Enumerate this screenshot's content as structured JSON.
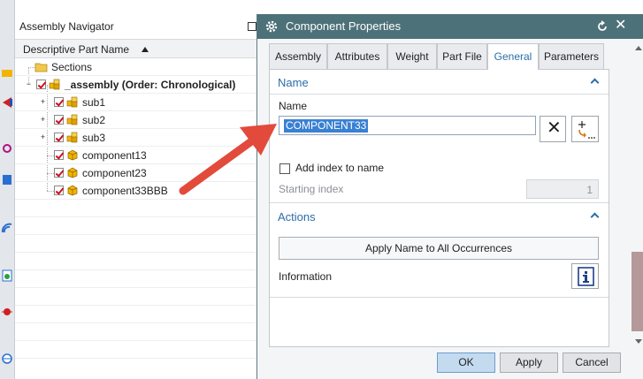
{
  "navigator": {
    "title": "Assembly Navigator",
    "column_header": "Descriptive Part Name",
    "rows": [
      {
        "label": "Sections",
        "bold": false
      },
      {
        "label": "_assembly (Order: Chronological)",
        "bold": true
      },
      {
        "label": "sub1",
        "bold": false
      },
      {
        "label": "sub2",
        "bold": false
      },
      {
        "label": "sub3",
        "bold": false
      },
      {
        "label": "component13",
        "bold": false
      },
      {
        "label": "component23",
        "bold": false
      },
      {
        "label": "component33BBB",
        "bold": false
      }
    ]
  },
  "dialog": {
    "title": "Component Properties",
    "tabs": [
      {
        "label": "Assembly",
        "active": false
      },
      {
        "label": "Attributes",
        "active": false
      },
      {
        "label": "Weight",
        "active": false
      },
      {
        "label": "Part File",
        "active": false
      },
      {
        "label": "General",
        "active": true
      },
      {
        "label": "Parameters",
        "active": false
      }
    ],
    "name_section": {
      "title": "Name",
      "field_label": "Name",
      "field_value": "COMPONENT33",
      "add_index_label": "Add index to name",
      "add_index_checked": false,
      "starting_index_label": "Starting index",
      "starting_index_value": "1"
    },
    "actions_section": {
      "title": "Actions",
      "apply_all_label": "Apply Name to All Occurrences",
      "information_label": "Information"
    },
    "buttons": {
      "ok": "OK",
      "apply": "Apply",
      "cancel": "Cancel"
    }
  },
  "colors": {
    "titlebar": "#4d7179",
    "accent": "#2a6ea8",
    "selection": "#3a80d3",
    "arrow": "#e24a3b",
    "check": "#d0101a"
  }
}
